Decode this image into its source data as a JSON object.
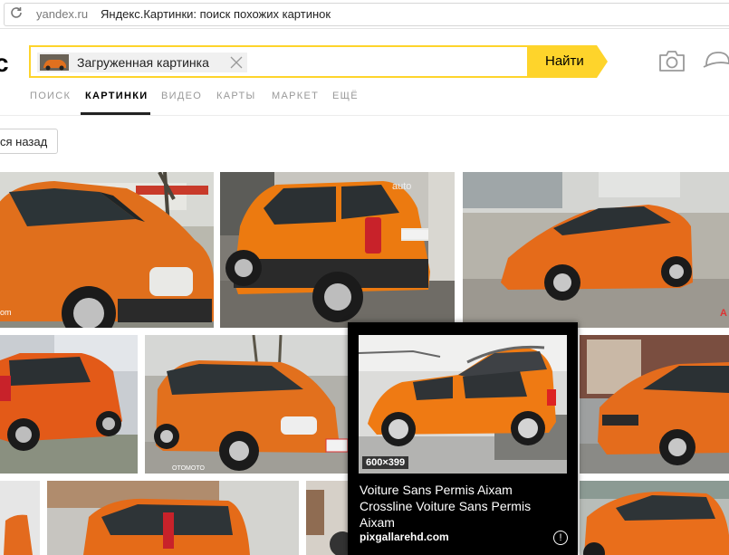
{
  "browser": {
    "domain": "yandex.ru",
    "page_title": "Яндекс.Картинки: поиск похожих картинок"
  },
  "header": {
    "logo_fragment": "c",
    "search": {
      "chip_label": "Загруженная картинка",
      "value": "",
      "button_label": "Найти"
    }
  },
  "tabs": [
    {
      "label": "ПОИСК",
      "active": false
    },
    {
      "label": "КАРТИНКИ",
      "active": true
    },
    {
      "label": "ВИДЕО",
      "active": false
    },
    {
      "label": "КАРТЫ",
      "active": false
    },
    {
      "label": "МАРКЕТ",
      "active": false
    },
    {
      "label": "ЕЩЁ",
      "active": false
    }
  ],
  "back_button_label": "ся назад",
  "watermarks": {
    "tile1": "om",
    "tile2": "auto",
    "tile6": "OTOMOTO",
    "tile3": "A"
  },
  "overlay": {
    "size": "600×399",
    "title": "Voiture Sans Permis Aixam Crossline Voiture Sans Permis Aixam",
    "source": "pixgallarehd.com",
    "info_icon": "!"
  },
  "colors": {
    "accent_yellow": "#fed42b",
    "car_orange": "#e8731f"
  }
}
